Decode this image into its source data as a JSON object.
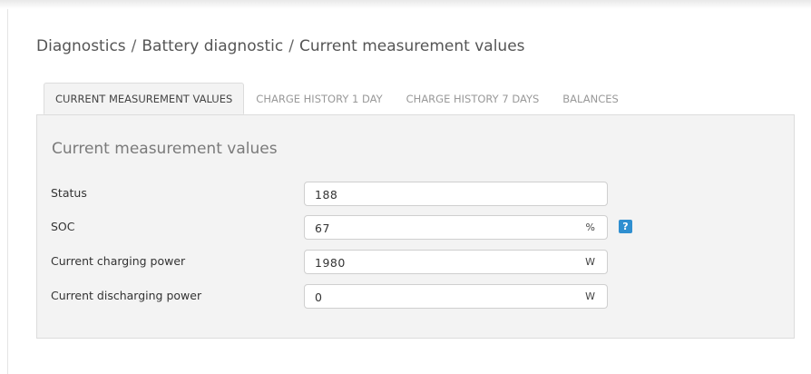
{
  "breadcrumb": {
    "parts": [
      "Diagnostics",
      "Battery diagnostic",
      "Current measurement values"
    ],
    "separator": "/"
  },
  "tabs": [
    {
      "label": "CURRENT MEASUREMENT VALUES",
      "active": true
    },
    {
      "label": "CHARGE HISTORY 1 DAY",
      "active": false
    },
    {
      "label": "CHARGE HISTORY 7 DAYS",
      "active": false
    },
    {
      "label": "BALANCES",
      "active": false
    }
  ],
  "panel": {
    "title": "Current measurement values",
    "rows": [
      {
        "label": "Status",
        "value": "188",
        "unit": ""
      },
      {
        "label": "SOC",
        "value": "67",
        "unit": "%",
        "help": "?"
      },
      {
        "label": "Current charging power",
        "value": "1980",
        "unit": "W"
      },
      {
        "label": "Current discharging power",
        "value": "0",
        "unit": "W"
      }
    ]
  },
  "colors": {
    "help_icon": "#2f8fd0",
    "panel_background": "#f3f3f3"
  },
  "icons": {
    "help": "help-icon"
  }
}
